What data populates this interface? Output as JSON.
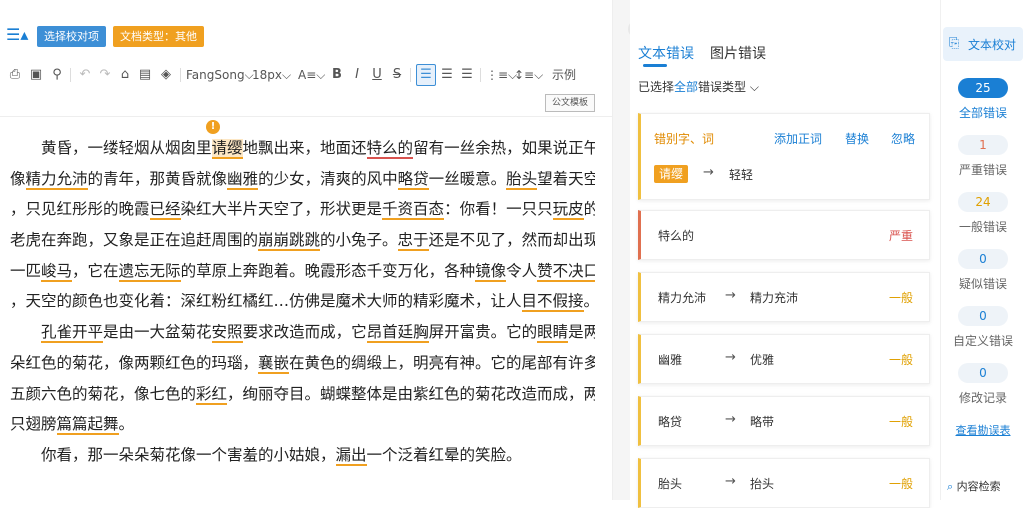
{
  "header": {
    "menu_icon": "list-icon",
    "select_proof_label": "选择校对项",
    "doc_type_label": "文档类型：其他"
  },
  "toolbar": {
    "font_name": "FangSong",
    "font_size": "18px",
    "example_label": "示例",
    "template_label": "公文模板"
  },
  "document": {
    "lines": [
      [
        {
          "t": "　　黄昏，一缕轻烟从烟囱里"
        },
        {
          "t": "请缨",
          "u": "o",
          "h": true
        },
        {
          "t": "地飘出来，地面还"
        },
        {
          "t": "特么的",
          "u": "r"
        },
        {
          "t": "留有一丝余热，如果说正午"
        }
      ],
      [
        {
          "t": "像"
        },
        {
          "t": "精力允沛",
          "u": "o"
        },
        {
          "t": "的青年，那黄昏就像"
        },
        {
          "t": "幽雅",
          "u": "o"
        },
        {
          "t": "的少女，清爽的风中"
        },
        {
          "t": "略贷",
          "u": "o"
        },
        {
          "t": "一丝暖意。"
        },
        {
          "t": "胎头",
          "u": "o"
        },
        {
          "t": "望着天空"
        }
      ],
      [
        {
          "t": "，只见红彤彤的晚霞"
        },
        {
          "t": "已经",
          "u": "o"
        },
        {
          "t": "染红大半片天空了，形状更是"
        },
        {
          "t": "千资百态",
          "u": "o"
        },
        {
          "t": "：你看！一只只"
        },
        {
          "t": "玩皮",
          "u": "o"
        },
        {
          "t": "的"
        }
      ],
      [
        {
          "t": "老虎在奔跑，又象是正在追赶周围的"
        },
        {
          "t": "崩崩跳跳",
          "u": "o"
        },
        {
          "t": "的小兔子。"
        },
        {
          "t": "忠于",
          "u": "o"
        },
        {
          "t": "还是不见了，然而却出现了"
        }
      ],
      [
        {
          "t": "一匹"
        },
        {
          "t": "峻马",
          "u": "o"
        },
        {
          "t": "，它在"
        },
        {
          "t": "遗忘无际",
          "u": "o"
        },
        {
          "t": "的草原上奔跑着。晚霞形态千变万化，各种"
        },
        {
          "t": "镜像",
          "u": "o"
        },
        {
          "t": "令人"
        },
        {
          "t": "赞不决口",
          "u": "o"
        }
      ],
      [
        {
          "t": "，天空的颜色也变化着：深红粉红橘红…仿佛是魔术大师的精彩魔术，让人"
        },
        {
          "t": "目不假接",
          "u": "o"
        },
        {
          "t": "。"
        }
      ],
      [
        {
          "t": "　　"
        },
        {
          "t": "孔雀开平",
          "u": "o"
        },
        {
          "t": "是由一大盆菊花"
        },
        {
          "t": "安照",
          "u": "o"
        },
        {
          "t": "要求改造而成，它"
        },
        {
          "t": "昂首廷胸",
          "u": "o"
        },
        {
          "t": "屏开富贵。它的"
        },
        {
          "t": "眼睛",
          "u": "o"
        },
        {
          "t": "是两"
        }
      ],
      [
        {
          "t": "朵红色的菊花，像两颗红色的玛瑙，"
        },
        {
          "t": "襄嵌",
          "u": "o"
        },
        {
          "t": "在黄色的绸缎上，明亮有神。它的尾部有许多"
        }
      ],
      [
        {
          "t": "五颜六色的菊花，像七色的"
        },
        {
          "t": "彩红",
          "u": "o"
        },
        {
          "t": "，绚丽夺目。蝴蝶整体是由紫红色的菊花改造而成，两"
        }
      ],
      [
        {
          "t": "只翅膀"
        },
        {
          "t": "篇篇起舞",
          "u": "o"
        },
        {
          "t": "。"
        }
      ],
      [
        {
          "t": "　　你看，那一朵朵菊花像一个害羞的小姑娘，"
        },
        {
          "t": "漏出",
          "u": "o"
        },
        {
          "t": "一个泛着红晕的笑脸。"
        }
      ]
    ]
  },
  "panel": {
    "tabs": [
      "文本错误",
      "图片错误"
    ],
    "filter_prefix": "已选择",
    "filter_all": "全部",
    "filter_suffix": "错误类型",
    "card1": {
      "title": "错别字、词",
      "add_label": "添加正词",
      "replace_label": "替换",
      "ignore_label": "忽略",
      "wrong": "请缨",
      "suggestion": "轻轻"
    },
    "cards": [
      {
        "wrong": "特么的",
        "suggestion": "",
        "severity": "严重",
        "color": "#d9534f"
      },
      {
        "wrong": "精力允沛",
        "suggestion": "精力充沛",
        "severity": "一般",
        "color": "#e0a000"
      },
      {
        "wrong": "幽雅",
        "suggestion": "优雅",
        "severity": "一般",
        "color": "#e0a000"
      },
      {
        "wrong": "略贷",
        "suggestion": "略带",
        "severity": "一般",
        "color": "#e0a000"
      },
      {
        "wrong": "胎头",
        "suggestion": "抬头",
        "severity": "一般",
        "color": "#e0a000"
      }
    ]
  },
  "rightbar": {
    "proof_label": "文本校对",
    "stats": [
      {
        "count": "25",
        "label": "全部错误"
      },
      {
        "count": "1",
        "label": "严重错误"
      },
      {
        "count": "24",
        "label": "一般错误"
      },
      {
        "count": "0",
        "label": "疑似错误"
      },
      {
        "count": "0",
        "label": "自定义错误"
      },
      {
        "count": "0",
        "label": "修改记录"
      }
    ],
    "view_table_label": "查看勘误表",
    "search_label": "内容检索"
  }
}
